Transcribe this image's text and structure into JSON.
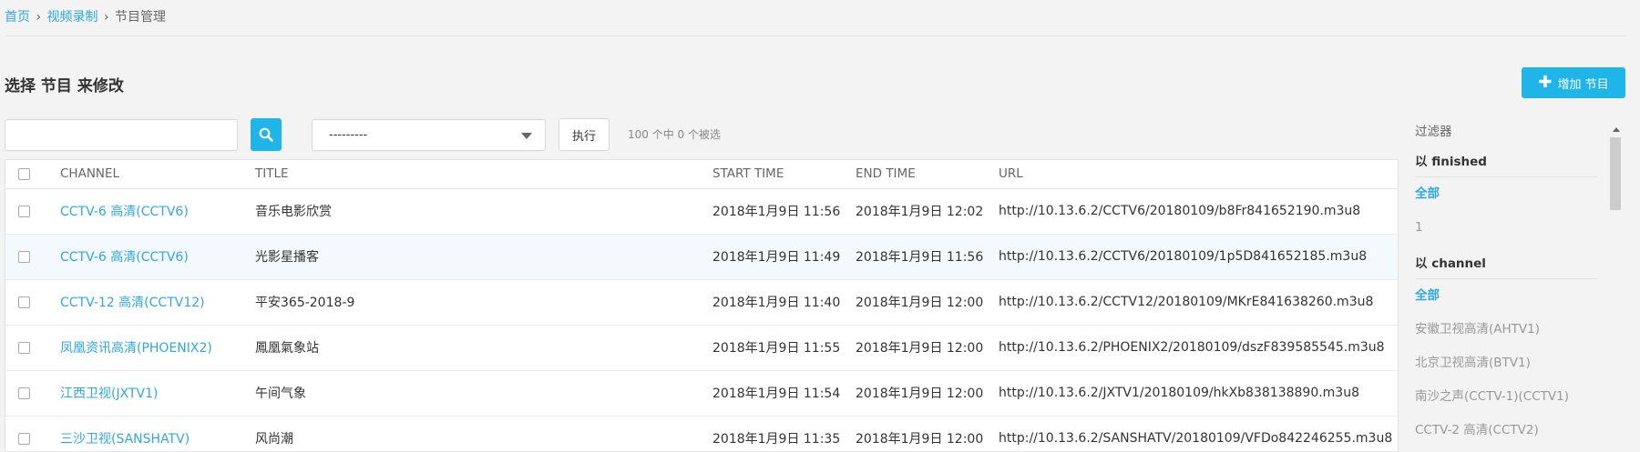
{
  "breadcrumb": {
    "home": "首页",
    "section": "视频录制",
    "current": "节目管理",
    "sep": "›"
  },
  "page_title": "选择 节目 来修改",
  "add_button": {
    "label": "增加 节目"
  },
  "search": {
    "value": "",
    "placeholder": ""
  },
  "action_select": {
    "selected": "---------"
  },
  "execute_button": "执行",
  "selection_counter": "100 个中 0 个被选",
  "table": {
    "headers": {
      "channel": "CHANNEL",
      "title": "TITLE",
      "start_time": "START TIME",
      "end_time": "END TIME",
      "url": "URL"
    },
    "rows": [
      {
        "channel": "CCTV-6 高清(CCTV6)",
        "title": "音乐电影欣赏",
        "start": "2018年1月9日 11:56",
        "end": "2018年1月9日 12:02",
        "url": "http://10.13.6.2/CCTV6/20180109/b8Fr841652190.m3u8",
        "highlight": false
      },
      {
        "channel": "CCTV-6 高清(CCTV6)",
        "title": "光影星播客",
        "start": "2018年1月9日 11:49",
        "end": "2018年1月9日 11:56",
        "url": "http://10.13.6.2/CCTV6/20180109/1p5D841652185.m3u8",
        "highlight": true
      },
      {
        "channel": "CCTV-12 高清(CCTV12)",
        "title": "平安365-2018-9",
        "start": "2018年1月9日 11:40",
        "end": "2018年1月9日 12:00",
        "url": "http://10.13.6.2/CCTV12/20180109/MKrE841638260.m3u8",
        "highlight": false
      },
      {
        "channel": "凤凰资讯高清(PHOENIX2)",
        "title": "鳳凰氣象站",
        "start": "2018年1月9日 11:55",
        "end": "2018年1月9日 12:00",
        "url": "http://10.13.6.2/PHOENIX2/20180109/dszF839585545.m3u8",
        "highlight": false
      },
      {
        "channel": "江西卫视(JXTV1)",
        "title": "午间气象",
        "start": "2018年1月9日 11:54",
        "end": "2018年1月9日 12:00",
        "url": "http://10.13.6.2/JXTV1/20180109/hkXb838138890.m3u8",
        "highlight": false
      },
      {
        "channel": "三沙卫视(SANSHATV)",
        "title": "风尚潮",
        "start": "2018年1月9日 11:35",
        "end": "2018年1月9日 12:00",
        "url": "http://10.13.6.2/SANSHATV/20180109/VFDo842246255.m3u8",
        "highlight": false
      }
    ]
  },
  "filter": {
    "heading": "过滤器",
    "finished": {
      "title": "以 finished",
      "items": [
        "全部",
        "1"
      ]
    },
    "channel": {
      "title": "以 channel",
      "items": [
        "全部",
        "安徽卫视高清(AHTV1)",
        "北京卫视高清(BTV1)",
        "南沙之声(CCTV-1)(CCTV1)",
        "CCTV-2 高清(CCTV2)"
      ]
    }
  },
  "colors": {
    "accent": "#1fb5e8",
    "link": "#2ea8e6",
    "background": "#f3f3f3"
  },
  "icons": {
    "search": "search-icon",
    "add": "plus-icon",
    "select": "chevron-down-icon"
  }
}
